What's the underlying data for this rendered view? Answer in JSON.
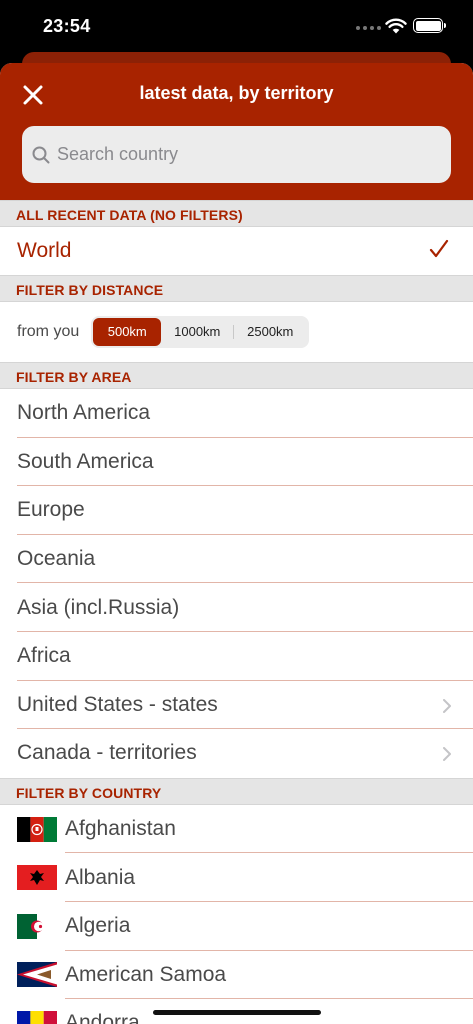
{
  "status": {
    "time": "23:54"
  },
  "header": {
    "title": "latest data, by territory",
    "search_placeholder": "Search country"
  },
  "sections": {
    "recent": {
      "title": "ALL RECENT DATA (NO FILTERS)",
      "world_label": "World"
    },
    "distance": {
      "title": "FILTER BY DISTANCE",
      "from_label": "from you",
      "options": [
        "500km",
        "1000km",
        "2500km"
      ],
      "selected": "500km"
    },
    "area": {
      "title": "FILTER BY AREA",
      "items": [
        "North America",
        "South America",
        "Europe",
        "Oceania",
        "Asia (incl.Russia)",
        "Africa",
        "United States - states",
        "Canada - territories"
      ]
    },
    "country": {
      "title": "FILTER BY COUNTRY",
      "items": [
        "Afghanistan",
        "Albania",
        "Algeria",
        "American Samoa",
        "Andorra"
      ]
    }
  },
  "colors": {
    "accent": "#a82300",
    "separator": "#e2b5a8",
    "section_bg": "#e5e5e5"
  }
}
